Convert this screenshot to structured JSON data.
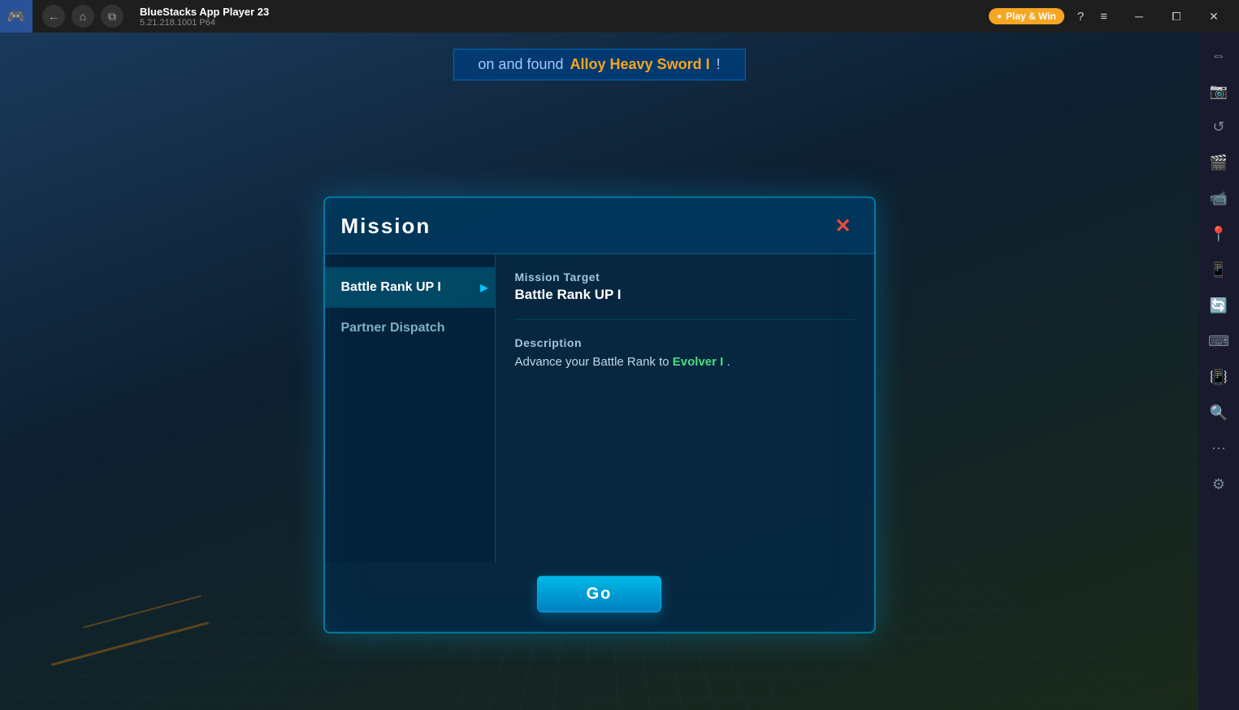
{
  "titlebar": {
    "app_name": "BlueStacks App Player 23",
    "version": "5.21.218.1001  P64",
    "logo": "🎮",
    "play_win_label": "Play & Win",
    "nav": {
      "back": "←",
      "home": "⌂",
      "tabs": "⧉"
    },
    "window_controls": {
      "help": "?",
      "menu": "≡",
      "minimize": "─",
      "restore": "⧠",
      "close": "✕"
    }
  },
  "sidebar": {
    "icons": [
      {
        "name": "expand",
        "glyph": "⇔"
      },
      {
        "name": "screenshot",
        "glyph": "📸"
      },
      {
        "name": "refresh",
        "glyph": "↺"
      },
      {
        "name": "camera",
        "glyph": "📷"
      },
      {
        "name": "video",
        "glyph": "🎬"
      },
      {
        "name": "location",
        "glyph": "📍"
      },
      {
        "name": "phone",
        "glyph": "📱"
      },
      {
        "name": "rotate",
        "glyph": "🔄"
      },
      {
        "name": "keyboard",
        "glyph": "⌨"
      },
      {
        "name": "shake",
        "glyph": "📳"
      },
      {
        "name": "search2",
        "glyph": "🔍"
      },
      {
        "name": "dots",
        "glyph": "⋯"
      },
      {
        "name": "settings",
        "glyph": "⚙"
      }
    ]
  },
  "notification": {
    "prefix": "on and found",
    "item_name": "Alloy Heavy Sword I",
    "suffix": "!"
  },
  "mission_dialog": {
    "title": "Mission",
    "close_label": "✕",
    "missions": [
      {
        "id": "battle-rank-up",
        "label": "Battle Rank UP I",
        "active": true
      },
      {
        "id": "partner-dispatch",
        "label": "Partner Dispatch",
        "active": false
      }
    ],
    "detail": {
      "section1_label": "Mission Target",
      "section1_value": "Battle Rank UP I",
      "section2_label": "Description",
      "section2_text": "Advance your Battle Rank to",
      "section2_highlight": "Evolver I",
      "section2_end": "."
    },
    "go_button_label": "Go"
  }
}
